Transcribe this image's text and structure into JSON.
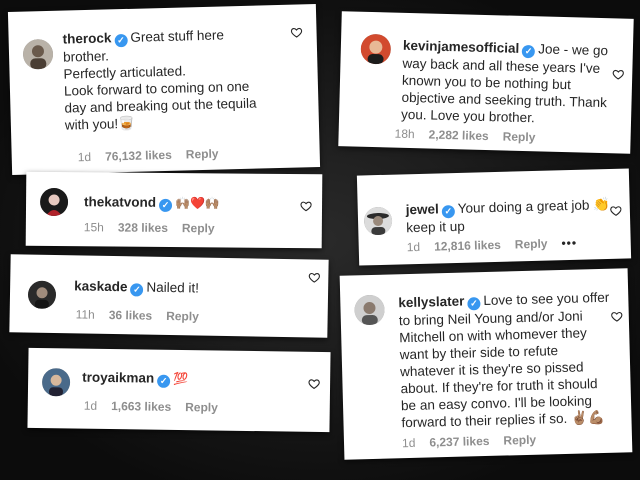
{
  "comments": [
    {
      "username": "therock",
      "lines": [
        "Great stuff here",
        "brother.",
        "Perfectly articulated.",
        "Look forward to coming on one",
        "day and breaking out the tequila",
        "with you!🥃"
      ],
      "time": "1d",
      "likes": "76,132 likes",
      "reply": "Reply"
    },
    {
      "username": "kevinjamesofficial",
      "lines": [
        "Joe - we go",
        "way back and all these years I've",
        "known you to be nothing but",
        "objective and seeking truth. Thank",
        "you. Love you brother."
      ],
      "time": "18h",
      "likes": "2,282 likes",
      "reply": "Reply"
    },
    {
      "username": "thekatvond",
      "text": "🙌🏽❤️🙌🏽",
      "time": "15h",
      "likes": "328 likes",
      "reply": "Reply"
    },
    {
      "username": "jewel",
      "lines": [
        "Your doing a great job 👏",
        "keep it up"
      ],
      "time": "1d",
      "likes": "12,816 likes",
      "reply": "Reply",
      "more": "•••"
    },
    {
      "username": "kaskade",
      "text": "Nailed it!",
      "time": "11h",
      "likes": "36 likes",
      "reply": "Reply"
    },
    {
      "username": "kellyslater",
      "lines": [
        "Love to see you offer",
        "to bring Neil Young and/or Joni",
        "Mitchell on with whomever they",
        "want by their side to refute",
        "whatever it is they're so pissed",
        "about. If they're for truth it should",
        "be an easy convo. I'll be looking",
        "forward to their replies if so. ✌🏽💪🏽"
      ],
      "time": "1d",
      "likes": "6,237 likes",
      "reply": "Reply"
    },
    {
      "username": "troyaikman",
      "text": "💯",
      "time": "1d",
      "likes": "1,663 likes",
      "reply": "Reply"
    }
  ],
  "icons": {
    "verified": "verified-badge-icon",
    "like": "heart-outline-icon"
  },
  "colors": {
    "verified": "#3897f0",
    "meta": "#8e8e8e",
    "background": "#141414"
  }
}
